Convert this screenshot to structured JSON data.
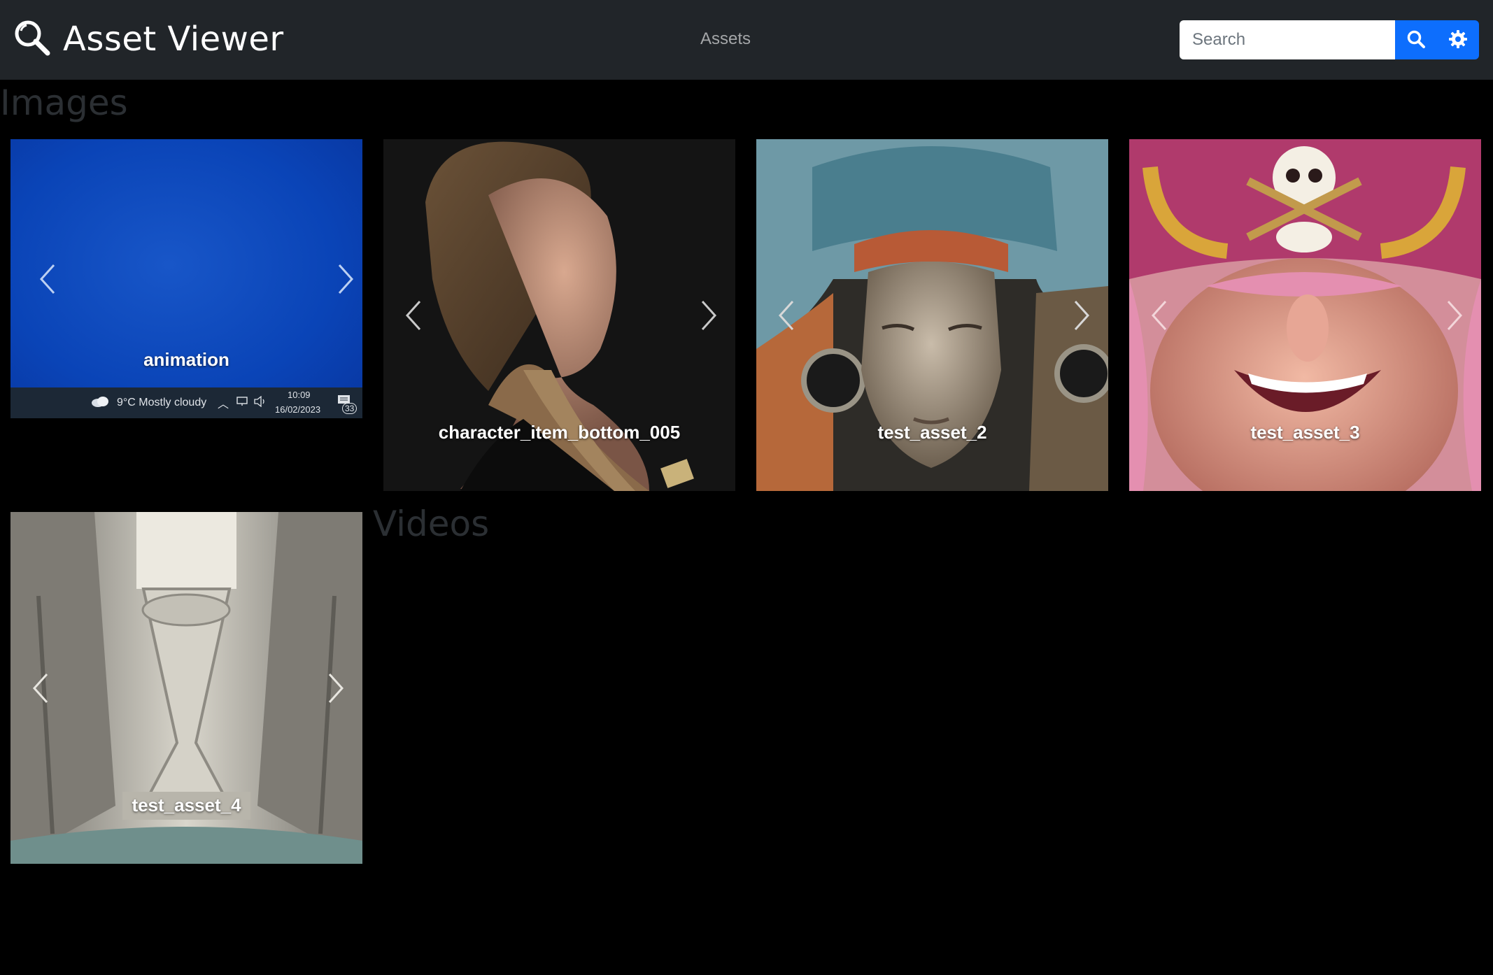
{
  "app": {
    "title": "Asset Viewer",
    "nav_link": "Assets",
    "search_placeholder": "Search"
  },
  "sections": {
    "images_title": "Images",
    "videos_title": "Videos"
  },
  "assets": [
    {
      "label": "animation"
    },
    {
      "label": "character_item_bottom_005"
    },
    {
      "label": "test_asset_2"
    },
    {
      "label": "test_asset_3"
    },
    {
      "label": "test_asset_4"
    }
  ],
  "taskbar": {
    "weather": "9°C  Mostly cloudy",
    "time": "10:09",
    "date": "16/02/2023",
    "notifications": "33"
  },
  "icons": {
    "brand": "magnifier-icon",
    "search": "search-icon",
    "settings": "gear-icon",
    "prev": "chevron-left-icon",
    "next": "chevron-right-icon"
  },
  "colors": {
    "navbar": "#212529",
    "accent": "#0d6efd",
    "background": "#000000"
  }
}
